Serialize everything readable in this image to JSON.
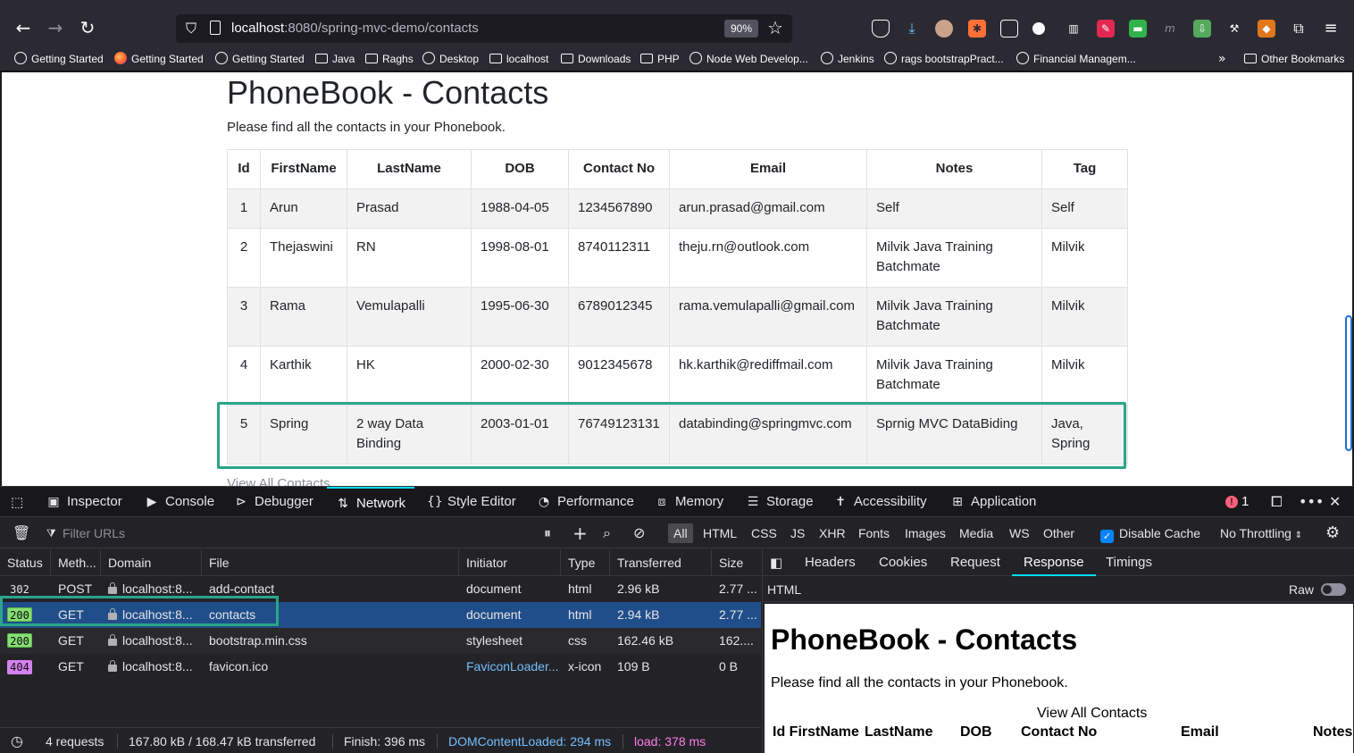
{
  "browser": {
    "url_host": "localhost",
    "url_rest": ":8080/spring-mvc-demo/contacts",
    "zoom": "90%",
    "bookmarks": [
      "Getting Started",
      "Getting Started",
      "Getting Started",
      "Java",
      "Raghs",
      "Desktop",
      "localhost",
      "Downloads",
      "PHP",
      "Node Web Develop...",
      "Jenkins",
      "rags bootstrapPract...",
      "Financial Managem..."
    ],
    "other_bookmarks": "Other Bookmarks"
  },
  "page": {
    "title": "PhoneBook - Contacts",
    "subtitle": "Please find all the contacts in your Phonebook.",
    "headers": [
      "Id",
      "FirstName",
      "LastName",
      "DOB",
      "Contact No",
      "Email",
      "Notes",
      "Tag"
    ],
    "rows": [
      [
        "1",
        "Arun",
        "Prasad",
        "1988-04-05",
        "1234567890",
        "arun.prasad@gmail.com",
        "Self",
        "Self"
      ],
      [
        "2",
        "Thejaswini",
        "RN",
        "1998-08-01",
        "8740112311",
        "theju.rn@outlook.com",
        "Milvik Java Training Batchmate",
        "Milvik"
      ],
      [
        "3",
        "Rama",
        "Vemulapalli",
        "1995-06-30",
        "6789012345",
        "rama.vemulapalli@gmail.com",
        "Milvik Java Training Batchmate",
        "Milvik"
      ],
      [
        "4",
        "Karthik",
        "HK",
        "2000-02-30",
        "9012345678",
        "hk.karthik@rediffmail.com",
        "Milvik Java Training Batchmate",
        "Milvik"
      ],
      [
        "5",
        "Spring",
        "2 way Data Binding",
        "2003-01-01",
        "76749123131",
        "databinding@springmvc.com",
        "Sprnig MVC DataBiding",
        "Java, Spring"
      ]
    ],
    "view_all": "View All Contacts"
  },
  "devtools": {
    "tabs": [
      "Inspector",
      "Console",
      "Debugger",
      "Network",
      "Style Editor",
      "Performance",
      "Memory",
      "Storage",
      "Accessibility",
      "Application"
    ],
    "error_count": "1",
    "filter_placeholder": "Filter URLs",
    "type_filters": [
      "All",
      "HTML",
      "CSS",
      "JS",
      "XHR",
      "Fonts",
      "Images",
      "Media",
      "WS",
      "Other"
    ],
    "disable_cache": "Disable Cache",
    "throttling": "No Throttling",
    "columns": [
      "Status",
      "Meth...",
      "Domain",
      "File",
      "Initiator",
      "Type",
      "Transferred",
      "Size"
    ],
    "requests": [
      {
        "status": "302",
        "method": "POST",
        "domain": "localhost:8...",
        "file": "add-contact",
        "initiator": "document",
        "type": "html",
        "transferred": "2.96 kB",
        "size": "2.77 ..."
      },
      {
        "status": "200",
        "method": "GET",
        "domain": "localhost:8...",
        "file": "contacts",
        "initiator": "document",
        "type": "html",
        "transferred": "2.94 kB",
        "size": "2.77 ..."
      },
      {
        "status": "200",
        "method": "GET",
        "domain": "localhost:8...",
        "file": "bootstrap.min.css",
        "initiator": "stylesheet",
        "type": "css",
        "transferred": "162.46 kB",
        "size": "162...."
      },
      {
        "status": "404",
        "method": "GET",
        "domain": "localhost:8...",
        "file": "favicon.ico",
        "initiator": "FaviconLoader...",
        "type": "x-icon",
        "transferred": "109 B",
        "size": "0 B"
      }
    ],
    "summary": {
      "requests": "4 requests",
      "transferred": "167.80 kB / 168.47 kB transferred",
      "finish": "Finish: 396 ms",
      "dcl": "DOMContentLoaded: 294 ms",
      "load": "load: 378 ms"
    },
    "detail_tabs": [
      "Headers",
      "Cookies",
      "Request",
      "Response",
      "Timings"
    ],
    "response_label": "HTML",
    "raw_label": "Raw",
    "preview": {
      "title": "PhoneBook - Contacts",
      "subtitle": "Please find all the contacts in your Phonebook.",
      "link": "View All Contacts",
      "headers": [
        "Id FirstName",
        "LastName",
        "DOB",
        "Contact No",
        "Email",
        "Notes"
      ]
    }
  },
  "colors": {
    "highlight": "#2aa58a",
    "selected_row": "#204e8a",
    "accent": "#00ddff"
  }
}
